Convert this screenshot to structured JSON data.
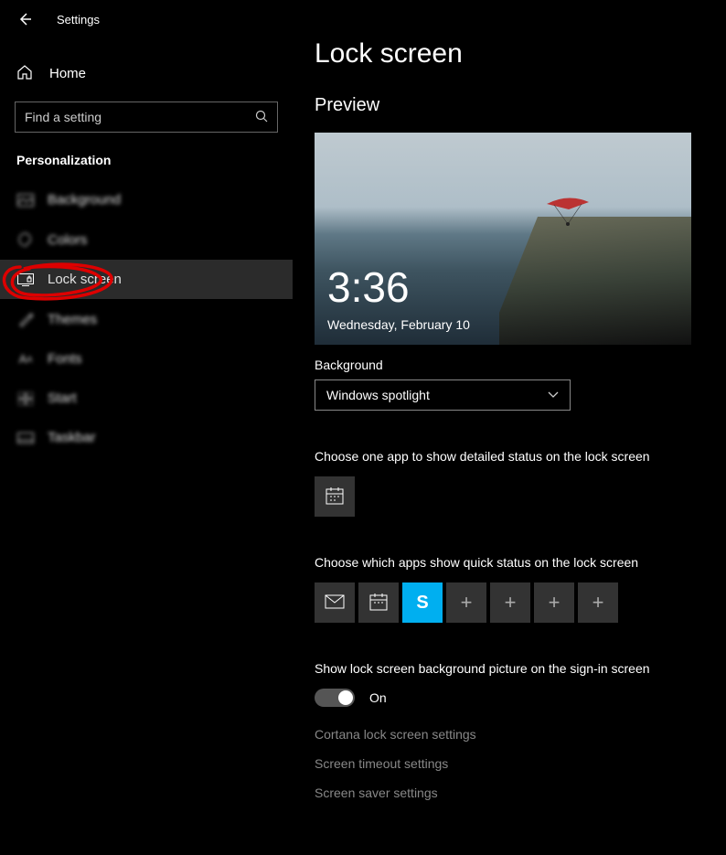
{
  "header": {
    "title": "Settings"
  },
  "home": {
    "label": "Home"
  },
  "search": {
    "placeholder": "Find a setting"
  },
  "category": "Personalization",
  "nav": [
    {
      "label": "Background"
    },
    {
      "label": "Colors"
    },
    {
      "label": "Lock screen"
    },
    {
      "label": "Themes"
    },
    {
      "label": "Fonts"
    },
    {
      "label": "Start"
    },
    {
      "label": "Taskbar"
    }
  ],
  "page": {
    "title": "Lock screen",
    "preview_heading": "Preview",
    "preview_time": "3:36",
    "preview_date": "Wednesday, February 10",
    "background_label": "Background",
    "background_value": "Windows spotlight",
    "detailed_label": "Choose one app to show detailed status on the lock screen",
    "detailed_app": "calendar-icon",
    "quick_label": "Choose which apps show quick status on the lock screen",
    "quick_apps": [
      "mail-icon",
      "calendar-icon",
      "skype-icon",
      "add",
      "add",
      "add",
      "add"
    ],
    "signin_label": "Show lock screen background picture on the sign-in screen",
    "signin_state": "On",
    "links": [
      "Cortana lock screen settings",
      "Screen timeout settings",
      "Screen saver settings"
    ]
  }
}
